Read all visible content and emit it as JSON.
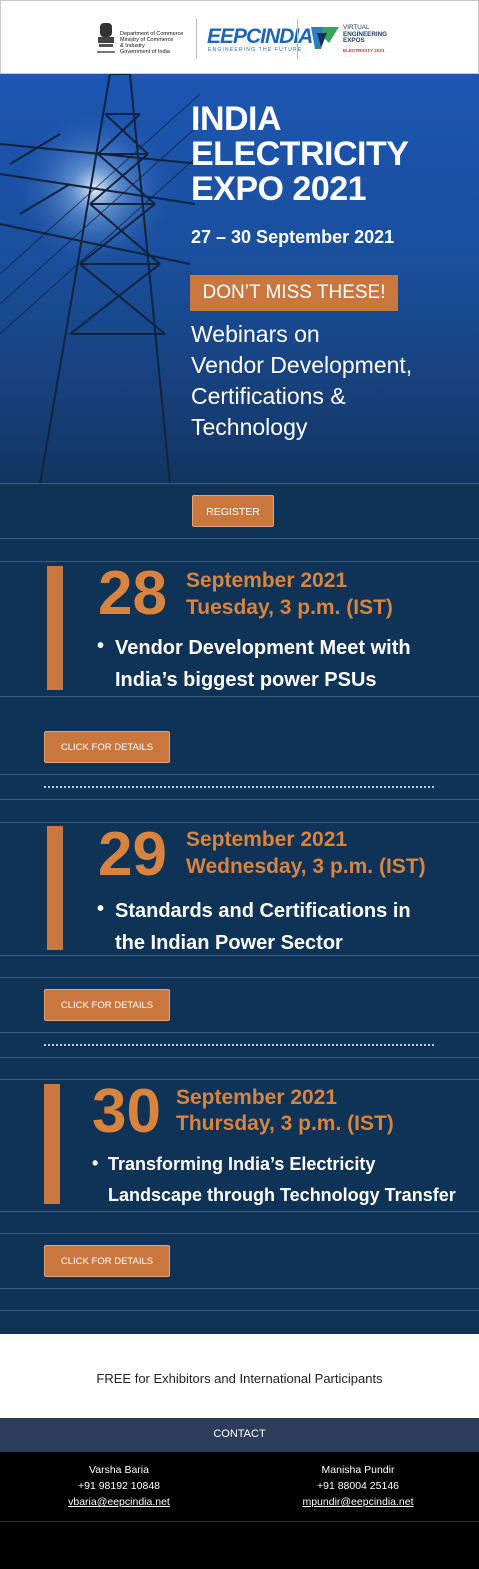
{
  "header": {
    "dept_lines": [
      "Department of Commerce",
      "Ministry of Commerce",
      "& Industry",
      "Government of India"
    ],
    "eepc_name": "EEPCINDIA",
    "eepc_tagline": "ENGINEERING THE FUTURE",
    "vee_lines": [
      "VIRTUAL",
      "ENGINEERING",
      "EXPOS"
    ],
    "vee_sub": "ELECTRICITY 2021"
  },
  "hero": {
    "title_lines": [
      "INDIA",
      "ELECTRICITY",
      "EXPO 2021"
    ],
    "dates": "27 – 30 September 2021",
    "dont_miss": "DON’T MISS THESE!",
    "subtitle_lines": [
      "Webinars on",
      "Vendor Development,",
      "Certifications &",
      "Technology"
    ]
  },
  "register_label": "REGISTER",
  "events": [
    {
      "day": "28",
      "month_year": "September 2021",
      "weekday_time": "Tuesday, 3 p.m. (IST)",
      "topic_lines": [
        "Vendor Development Meet with",
        "India’s biggest power PSUs"
      ],
      "button": "CLICK FOR DETAILS"
    },
    {
      "day": "29",
      "month_year": "September 2021",
      "weekday_time": "Wednesday, 3 p.m. (IST)",
      "topic_lines": [
        "Standards and Certifications in",
        "the Indian Power Sector"
      ],
      "button": "CLICK FOR DETAILS"
    },
    {
      "day": "30",
      "month_year": "September 2021",
      "weekday_time": "Thursday, 3 p.m. (IST)",
      "topic_lines": [
        "Transforming India’s Electricity",
        "Landscape through Technology Transfer"
      ],
      "button": "CLICK FOR DETAILS"
    }
  ],
  "free_note": "FREE for Exhibitors and International Participants",
  "contact_heading": "CONTACT",
  "contacts": [
    {
      "name": "Varsha Baria",
      "phone": "+91 98192 10848",
      "email": "vbaria@eepcindia.net"
    },
    {
      "name": "Manisha Pundir",
      "phone": "+91 88004 25146",
      "email": "mpundir@eepcindia.net"
    }
  ],
  "colors": {
    "accent": "#c9773f",
    "navy": "#0e3356",
    "hero_blue": "#1c56b3"
  }
}
